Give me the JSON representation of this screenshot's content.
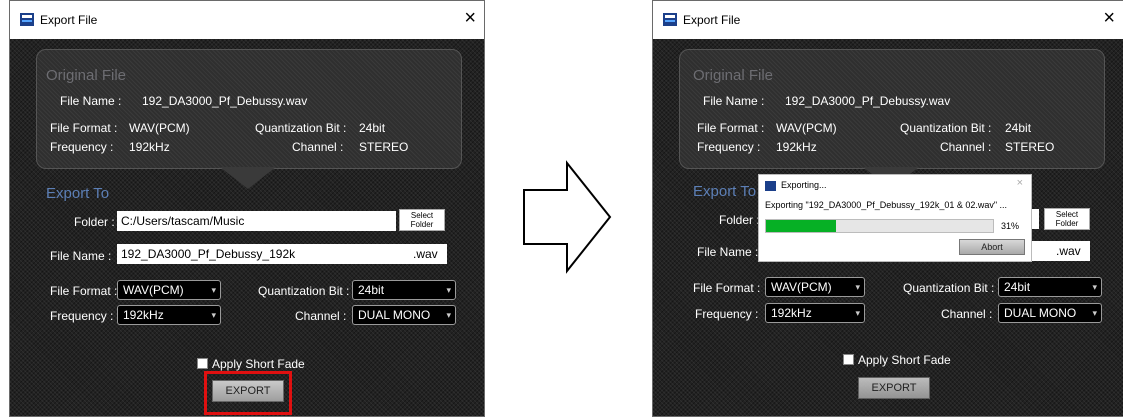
{
  "window_title": "Export File",
  "close_symbol": "×",
  "original": {
    "heading": "Original File",
    "file_name_label": "File Name :",
    "file_name": "192_DA3000_Pf_Debussy.wav",
    "format_label": "File Format :",
    "format": "WAV(PCM)",
    "qbit_label": "Quantization Bit :",
    "qbit": "24bit",
    "freq_label": "Frequency :",
    "freq": "192kHz",
    "channel_label": "Channel :",
    "channel": "STEREO"
  },
  "export_to": {
    "heading": "Export To",
    "folder_label": "Folder :",
    "folder": "C:/Users/tascam/Music",
    "select_folder_line1": "Select",
    "select_folder_line2": "Folder",
    "file_name_label": "File Name :",
    "file_name": "192_DA3000_Pf_Debussy_192k",
    "ext": ".wav",
    "format_label": "File Format :",
    "format": "WAV(PCM)",
    "qbit_label": "Quantization Bit :",
    "qbit": "24bit",
    "freq_label": "Frequency :",
    "freq": "192kHz",
    "channel_label": "Channel :",
    "channel": "DUAL MONO",
    "dropdown_arrow": "▾"
  },
  "apply_short_fade": "Apply Short Fade",
  "export_button": "EXPORT",
  "progress": {
    "title": "Exporting...",
    "message": "Exporting \"192_DA3000_Pf_Debussy_192k_01 & 02.wav\" ...",
    "percent_text": "31%",
    "fraction": 0.31,
    "abort_label": "Abort",
    "close_symbol": "×"
  },
  "colors": {
    "accent_blue": "#5c7fb6",
    "progress_green": "#06b025",
    "highlight_red": "#e01010"
  },
  "icons": [
    "export-app-icon",
    "close-icon",
    "dropdown-arrow-icon",
    "right-arrow-icon",
    "checkbox-icon"
  ]
}
